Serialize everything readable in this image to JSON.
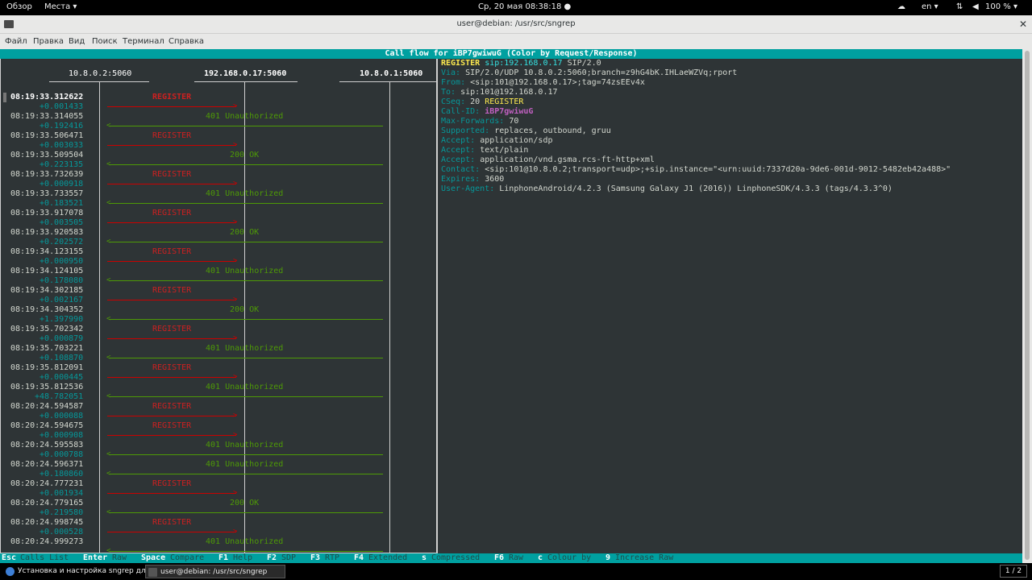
{
  "topbar": {
    "overview": "Обзор",
    "places": "Места ▾",
    "clock": "Ср, 20 мая  08:38:18 ●",
    "lang": "en ▾",
    "battery": "100 % ▾"
  },
  "window": {
    "title": "user@debian: /usr/src/sngrep",
    "close": "✕"
  },
  "menu": [
    "Файл",
    "Правка",
    "Вид",
    "Поиск",
    "Терминал",
    "Справка"
  ],
  "flow": {
    "header": "Call flow for iBP7gwiwuG (Color by Request/Response)",
    "hosts": [
      "10.8.0.2:5060",
      "192.168.0.17:5060",
      "10.8.0.1:5060"
    ],
    "messages": [
      {
        "ts": "08:19:33.312622",
        "delta": "+0.001433",
        "label": "REGISTER",
        "dir": "req"
      },
      {
        "ts": "08:19:33.314055",
        "delta": "+0.192416",
        "label": "401 Unauthorized",
        "dir": "res"
      },
      {
        "ts": "08:19:33.506471",
        "delta": "+0.003033",
        "label": "REGISTER",
        "dir": "req"
      },
      {
        "ts": "08:19:33.509504",
        "delta": "+0.223135",
        "label": "200 OK",
        "dir": "res"
      },
      {
        "ts": "08:19:33.732639",
        "delta": "+0.000918",
        "label": "REGISTER",
        "dir": "req"
      },
      {
        "ts": "08:19:33.733557",
        "delta": "+0.183521",
        "label": "401 Unauthorized",
        "dir": "res"
      },
      {
        "ts": "08:19:33.917078",
        "delta": "+0.003505",
        "label": "REGISTER",
        "dir": "req"
      },
      {
        "ts": "08:19:33.920583",
        "delta": "+0.202572",
        "label": "200 OK",
        "dir": "res"
      },
      {
        "ts": "08:19:34.123155",
        "delta": "+0.000950",
        "label": "REGISTER",
        "dir": "req"
      },
      {
        "ts": "08:19:34.124105",
        "delta": "+0.178080",
        "label": "401 Unauthorized",
        "dir": "res"
      },
      {
        "ts": "08:19:34.302185",
        "delta": "+0.002167",
        "label": "REGISTER",
        "dir": "req"
      },
      {
        "ts": "08:19:34.304352",
        "delta": "+1.397990",
        "label": "200 OK",
        "dir": "res"
      },
      {
        "ts": "08:19:35.702342",
        "delta": "+0.000879",
        "label": "REGISTER",
        "dir": "req"
      },
      {
        "ts": "08:19:35.703221",
        "delta": "+0.108870",
        "label": "401 Unauthorized",
        "dir": "res"
      },
      {
        "ts": "08:19:35.812091",
        "delta": "+0.000445",
        "label": "REGISTER",
        "dir": "req"
      },
      {
        "ts": "08:19:35.812536",
        "delta": "+48.782051",
        "label": "401 Unauthorized",
        "dir": "res"
      },
      {
        "ts": "08:20:24.594587",
        "delta": "+0.000088",
        "label": "REGISTER",
        "dir": "req"
      },
      {
        "ts": "08:20:24.594675",
        "delta": "+0.000908",
        "label": "REGISTER",
        "dir": "req"
      },
      {
        "ts": "08:20:24.595583",
        "delta": "+0.000788",
        "label": "401 Unauthorized",
        "dir": "res"
      },
      {
        "ts": "08:20:24.596371",
        "delta": "+0.180860",
        "label": "401 Unauthorized",
        "dir": "res"
      },
      {
        "ts": "08:20:24.777231",
        "delta": "+0.001934",
        "label": "REGISTER",
        "dir": "req"
      },
      {
        "ts": "08:20:24.779165",
        "delta": "+0.219580",
        "label": "200 OK",
        "dir": "res"
      },
      {
        "ts": "08:20:24.998745",
        "delta": "+0.000528",
        "label": "REGISTER",
        "dir": "req"
      },
      {
        "ts": "08:20:24.999273",
        "delta": "",
        "label": "401 Unauthorized",
        "dir": "res"
      }
    ]
  },
  "detail": {
    "request_line": {
      "method": "REGISTER",
      "uri": "sip:192.168.0.17",
      "version": "SIP/2.0"
    },
    "headers": [
      {
        "k": "Via:",
        "v": "SIP/2.0/UDP 10.8.0.2:5060;branch=z9hG4bK.IHLaeWZVq;rport"
      },
      {
        "k": "From:",
        "v": "<sip:101@192.168.0.17>;tag=74zsEEv4x"
      },
      {
        "k": "To:",
        "v": "sip:101@192.168.0.17"
      },
      {
        "k": "CSeq:",
        "v": "20 ",
        "v2": "REGISTER"
      },
      {
        "k": "Call-ID:",
        "v": "",
        "v3": "iBP7gwiwuG"
      },
      {
        "k": "Max-Forwards:",
        "v": "70"
      },
      {
        "k": "Supported:",
        "v": "replaces, outbound, gruu"
      },
      {
        "k": "Accept:",
        "v": "application/sdp"
      },
      {
        "k": "Accept:",
        "v": "text/plain"
      },
      {
        "k": "Accept:",
        "v": "application/vnd.gsma.rcs-ft-http+xml"
      },
      {
        "k": "Contact:",
        "v": "<sip:101@10.8.0.2;transport=udp>;+sip.instance=\"<urn:uuid:7337d20a-9de6-001d-9012-5482eb42a488>\""
      },
      {
        "k": "Expires:",
        "v": "3600"
      },
      {
        "k": "User-Agent:",
        "v": "LinphoneAndroid/4.2.3 (Samsung Galaxy J1 (2016)) LinphoneSDK/4.3.3 (tags/4.3.3^0)"
      }
    ]
  },
  "keybar": [
    {
      "key": "Esc",
      "action": "Calls List"
    },
    {
      "key": "Enter",
      "action": "Raw"
    },
    {
      "key": "Space",
      "action": "Compare"
    },
    {
      "key": "F1",
      "action": "Help"
    },
    {
      "key": "F2",
      "action": "SDP"
    },
    {
      "key": "F3",
      "action": "RTP"
    },
    {
      "key": "F4",
      "action": "Extended"
    },
    {
      "key": "s",
      "action": "Compressed"
    },
    {
      "key": "F6",
      "action": "Raw"
    },
    {
      "key": "c",
      "action": "Colour by"
    },
    {
      "key": "9",
      "action": "Increase Raw"
    }
  ],
  "taskbar": {
    "task1": "Установка и настройка sngrep дл...",
    "task2": "user@debian: /usr/src/sngrep",
    "pager": "1 / 2"
  }
}
